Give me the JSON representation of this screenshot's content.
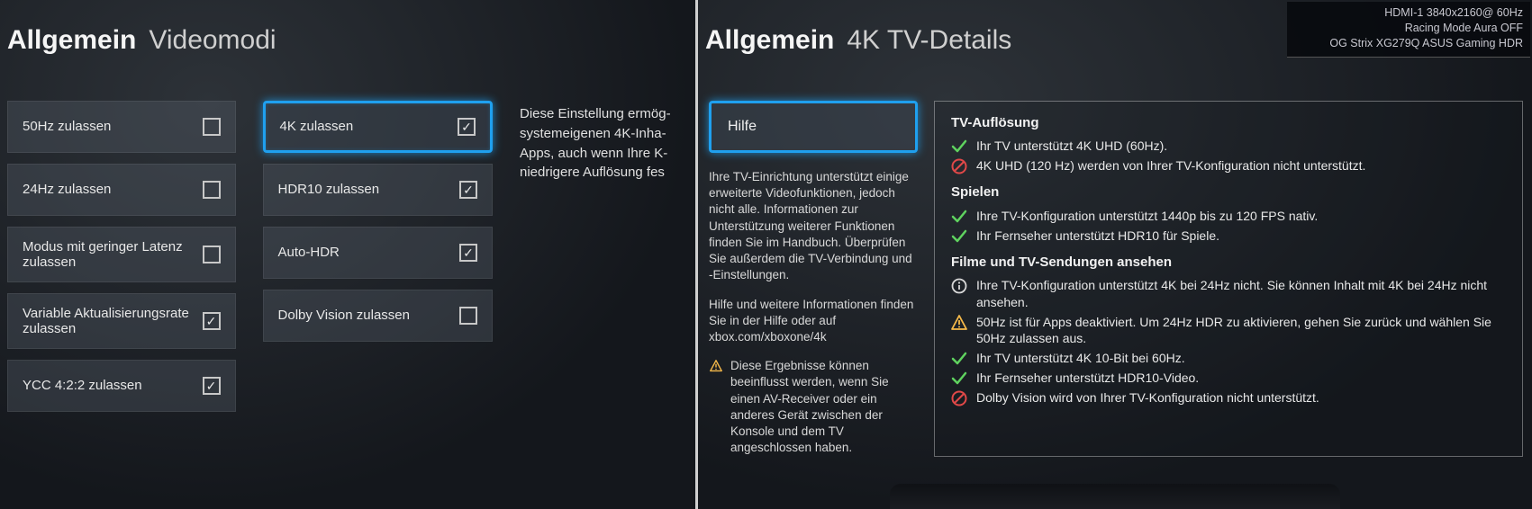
{
  "left": {
    "header": {
      "breadcrumb": "Allgemein",
      "title": "Videomodi"
    },
    "col1": [
      {
        "label": "50Hz zulassen",
        "checked": false
      },
      {
        "label": "24Hz zulassen",
        "checked": false
      },
      {
        "label": "Modus mit geringer Latenz zulassen",
        "checked": false
      },
      {
        "label": "Variable Aktualisierungsrate zulassen",
        "checked": true
      },
      {
        "label": "YCC 4:2:2 zulassen",
        "checked": true
      }
    ],
    "col2": [
      {
        "label": "4K zulassen",
        "checked": true,
        "selected": true
      },
      {
        "label": "HDR10 zulassen",
        "checked": true
      },
      {
        "label": "Auto-HDR",
        "checked": true
      },
      {
        "label": "Dolby Vision zulassen",
        "checked": false
      }
    ],
    "description": "Diese Einstellung ermög­systemeigenen 4K-Inha­Apps, auch wenn Ihre K­niedrigere Auflösung fes"
  },
  "right": {
    "header": {
      "breadcrumb": "Allgemein",
      "title": "4K TV-Details"
    },
    "help_button": "Hilfe",
    "help_para1": "Ihre TV-Einrichtung unterstützt einige erweiterte Videofunktionen, jedoch nicht alle. Informationen zur Unterstützung weiterer Funktionen finden Sie im Handbuch. Überprüfen Sie außerdem die TV-Verbindung und -Einstellungen.",
    "help_para2": "Hilfe und weitere Informationen finden Sie in der Hilfe oder auf xbox.com/xboxone/4k",
    "help_warn": "Diese Ergebnisse können beeinflusst werden, wenn Sie einen AV-Receiver oder ein anderes Gerät zwischen der Konsole und dem TV angeschlossen haben.",
    "sections": {
      "res": {
        "heading": "TV-Auflösung",
        "items": [
          {
            "icon": "check",
            "text": "Ihr TV unterstützt 4K UHD (60Hz)."
          },
          {
            "icon": "no",
            "text": "4K UHD (120 Hz) werden von Ihrer TV-Konfiguration nicht unterstützt."
          }
        ]
      },
      "play": {
        "heading": "Spielen",
        "items": [
          {
            "icon": "check",
            "text": "Ihre TV-Konfiguration unterstützt 1440p bis zu 120 FPS nativ."
          },
          {
            "icon": "check",
            "text": "Ihr Fernseher unterstützt HDR10 für Spiele."
          }
        ]
      },
      "movies": {
        "heading": "Filme und TV-Sendungen ansehen",
        "items": [
          {
            "icon": "info",
            "text": "Ihre TV-Konfiguration unterstützt 4K bei 24Hz nicht. Sie können Inhalt mit 4K bei 24Hz nicht ansehen."
          },
          {
            "icon": "warn",
            "text": "50Hz ist für Apps deaktiviert. Um 24Hz HDR zu aktivieren, gehen Sie zurück und wählen Sie 50Hz zulassen aus."
          },
          {
            "icon": "check",
            "text": "Ihr TV unterstützt 4K 10-Bit bei 60Hz."
          },
          {
            "icon": "check",
            "text": "Ihr Fernseher unterstützt HDR10-Video."
          },
          {
            "icon": "no",
            "text": "Dolby Vision wird von Ihrer TV-Konfiguration nicht unterstützt."
          }
        ]
      }
    },
    "osd": {
      "line1": "HDMI-1   3840x2160@  60Hz",
      "line2": "Racing Mode   Aura OFF",
      "line3": "OG Strix  XG279Q   ASUS Gaming HDR"
    }
  }
}
